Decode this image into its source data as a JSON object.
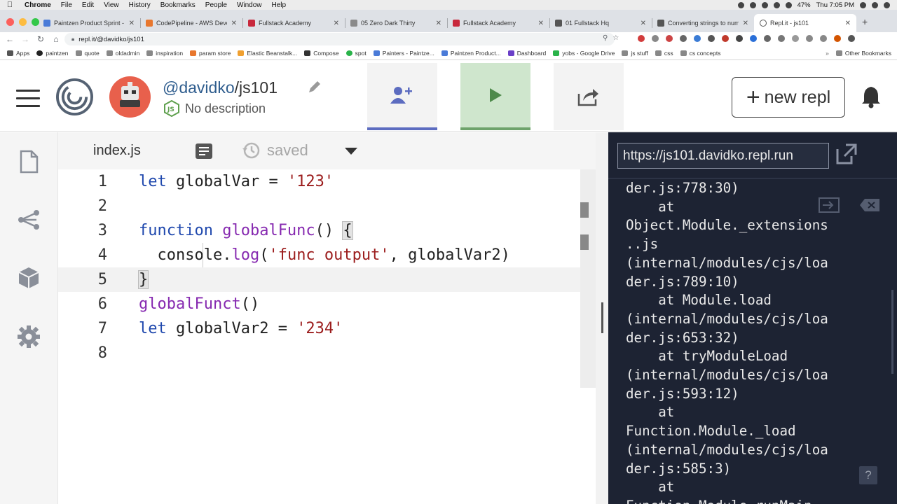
{
  "menubar": {
    "app": "Chrome",
    "items": [
      "File",
      "Edit",
      "View",
      "History",
      "Bookmarks",
      "People",
      "Window",
      "Help"
    ],
    "battery": "47%",
    "clock": "Thu 7:05 PM"
  },
  "tabs": [
    {
      "label": "Paintzen Product Sprint - A",
      "color": "#4a7bd8"
    },
    {
      "label": "CodePipeline - AWS Develo",
      "color": "#e8772e"
    },
    {
      "label": "Fullstack Academy",
      "color": "#c8283c"
    },
    {
      "label": "05 Zero Dark Thirty",
      "color": "#8a8a8a"
    },
    {
      "label": "Fullstack Academy",
      "color": "#c8283c"
    },
    {
      "label": "01 Fullstack Hq",
      "color": "#555555"
    },
    {
      "label": "Converting strings to numb",
      "color": "#555555"
    },
    {
      "label": "Repl.it - js101",
      "color": "#555555"
    }
  ],
  "address": {
    "url": "repl.it/@davidko/js101"
  },
  "bookmarks": [
    {
      "label": "Apps",
      "color": "#555555"
    },
    {
      "label": "paintzen",
      "color": "#222222"
    },
    {
      "label": "quote",
      "color": "#888888"
    },
    {
      "label": "oldadmin",
      "color": "#888888"
    },
    {
      "label": "inspiration",
      "color": "#888888"
    },
    {
      "label": "param store",
      "color": "#e8772e"
    },
    {
      "label": "Elastic Beanstalk...",
      "color": "#f0a030"
    },
    {
      "label": "Compose",
      "color": "#333333"
    },
    {
      "label": "spot",
      "color": "#2ab34a"
    },
    {
      "label": "Painters - Paintze...",
      "color": "#4a7bd8"
    },
    {
      "label": "Paintzen Product...",
      "color": "#4a7bd8"
    },
    {
      "label": "Dashboard",
      "color": "#6a3fc8"
    },
    {
      "label": "yobs - Google Drive",
      "color": "#2ab34a"
    },
    {
      "label": "js stuff",
      "color": "#888888"
    },
    {
      "label": "css",
      "color": "#888888"
    },
    {
      "label": "cs concepts",
      "color": "#888888"
    }
  ],
  "other_bookmarks": "Other Bookmarks",
  "repl": {
    "user": "@davidko",
    "slash": "/",
    "name": "js101",
    "description": "No description",
    "new_repl_label": "new repl"
  },
  "editor": {
    "filename": "index.js",
    "saved_label": "saved",
    "active_line": 5
  },
  "code_lines": [
    {
      "n": "1"
    },
    {
      "n": "2"
    },
    {
      "n": "3"
    },
    {
      "n": "4"
    },
    {
      "n": "5"
    },
    {
      "n": "6"
    },
    {
      "n": "7"
    },
    {
      "n": "8"
    }
  ],
  "code": {
    "l1_kw": "let",
    "l1_rest": " globalVar = ",
    "l1_str": "'123'",
    "l3_kw": "function",
    "l3_sp": " ",
    "l3_fn": "globalFunc",
    "l3_rest": "() ",
    "l3_br": "{",
    "l4_a": "  console.",
    "l4_fn": "log",
    "l4_b": "(",
    "l4_str": "'func output'",
    "l4_c": ", globalVar2)",
    "l5_br": "}",
    "l6_fn": "globalFunct",
    "l6_rest": "()",
    "l7_kw": "let",
    "l7_rest": " globalVar2 = ",
    "l7_str": "'234'"
  },
  "console": {
    "url": "https://js101.davidko.repl.run",
    "output": "der.js:778:30)\n    at\nObject.Module._extensions\n..js\n(internal/modules/cjs/loa\nder.js:789:10)\n    at Module.load\n(internal/modules/cjs/loa\nder.js:653:32)\n    at tryModuleLoad\n(internal/modules/cjs/loa\nder.js:593:12)\n    at\nFunction.Module._load\n(internal/modules/cjs/loa\nder.js:585:3)\n    at\nFunction.Module.runMain",
    "help": "?"
  }
}
